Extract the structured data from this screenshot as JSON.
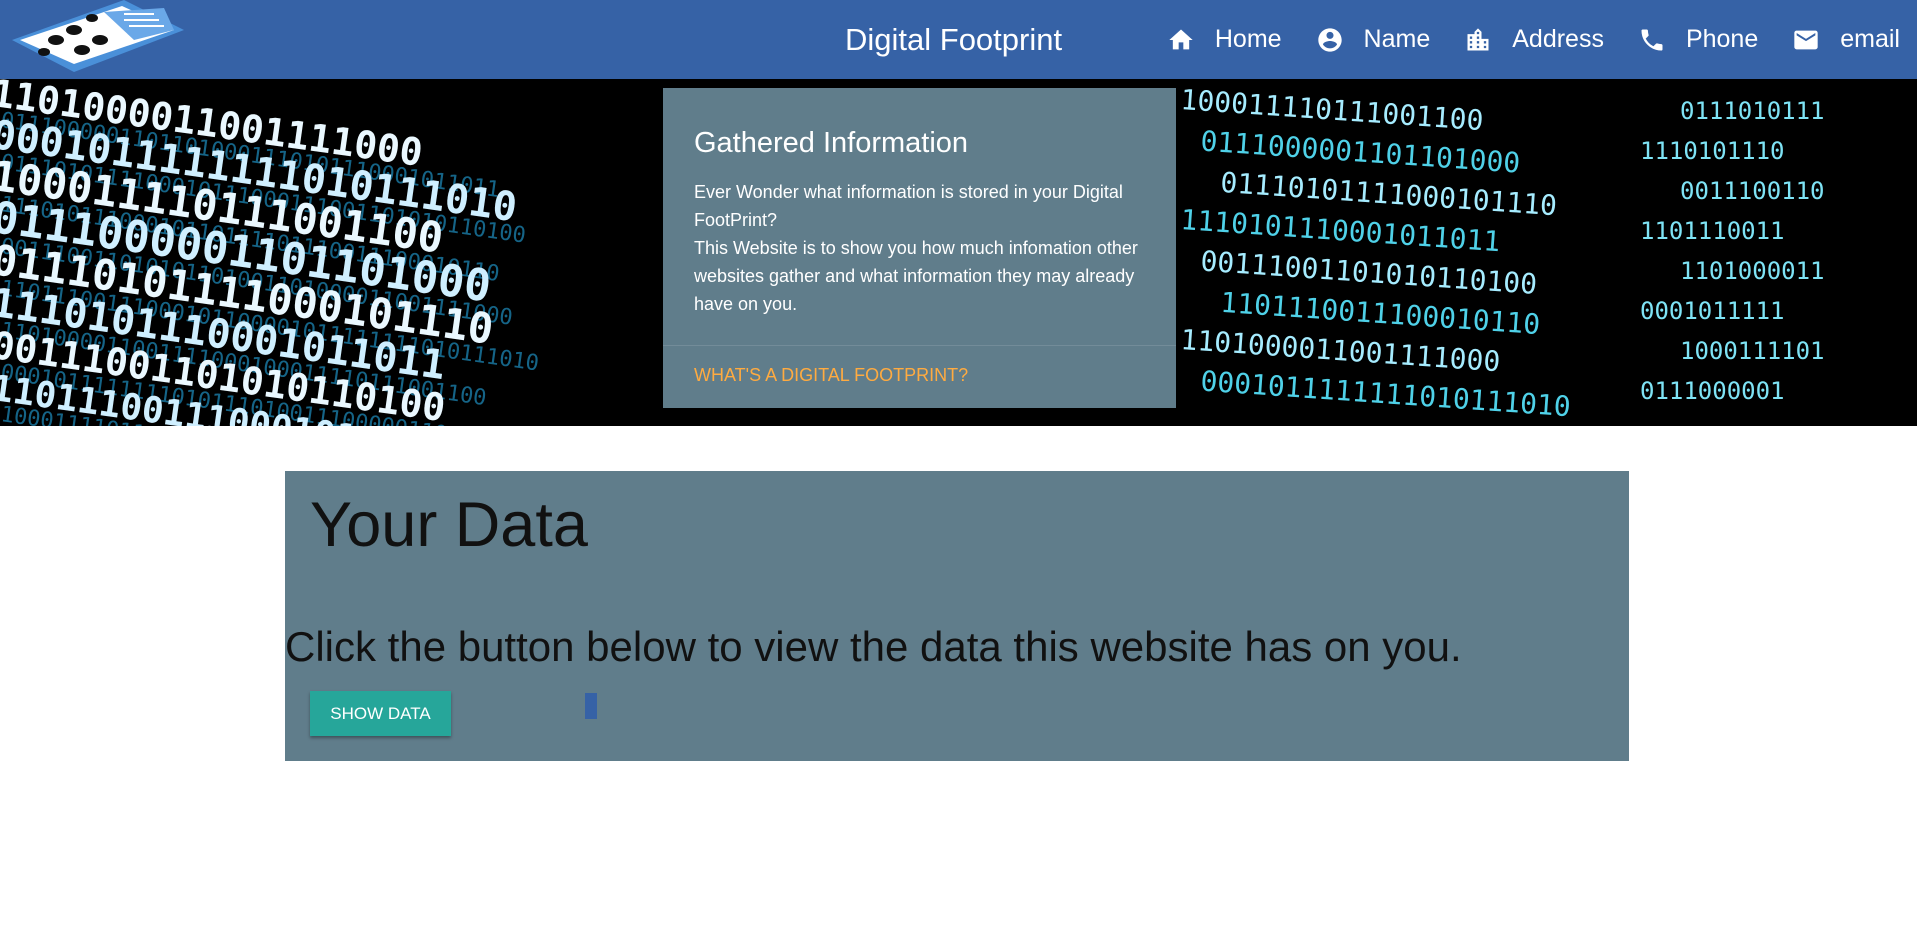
{
  "nav": {
    "brand": "Digital Footprint",
    "links": [
      {
        "label": "Home",
        "icon": "home-icon"
      },
      {
        "label": "Name",
        "icon": "account-circle-icon"
      },
      {
        "label": "Address",
        "icon": "building-icon"
      },
      {
        "label": "Phone",
        "icon": "phone-icon"
      },
      {
        "label": "email",
        "icon": "mail-icon"
      }
    ],
    "color": "#3662a6"
  },
  "card": {
    "title": "Gathered Information",
    "line1": "Ever Wonder what information is stored in your Digital FootPrint?",
    "line2": "This Website is to show you how much infomation other websites gather and what information they may already have on you.",
    "link": "What's a Digital Footprint?",
    "link_color": "#ffab40"
  },
  "data_panel": {
    "title": "Your Data",
    "description": "Click the button below to view the data this website has on you.",
    "button": "Show Data",
    "button_color": "#26a69a"
  },
  "hero": {
    "binary_rows": [
      "1101000011001111000",
      "0001011111111010111010",
      "100011110111001100",
      "0111000001101101000",
      "01110101111000101110",
      "1110101110001011011",
      "00111001101010110100",
      "1101110011100010110"
    ]
  }
}
